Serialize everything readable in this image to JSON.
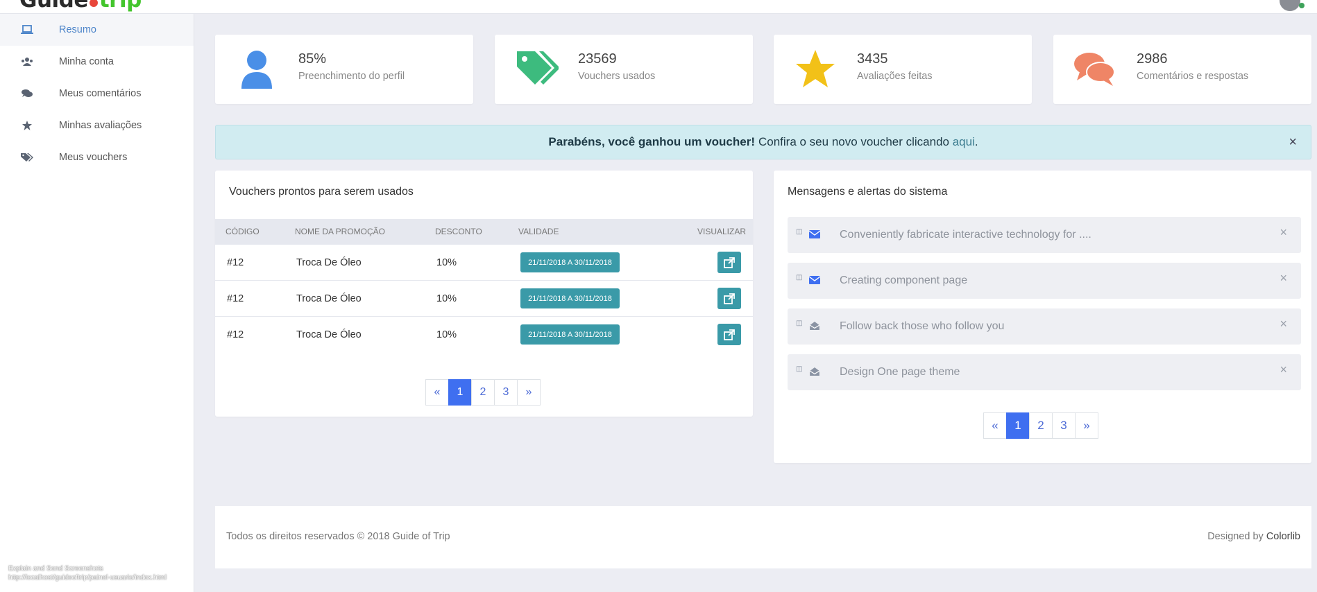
{
  "header": {
    "logo_part1": "Guide",
    "logo_part2": "trip",
    "logo_dot_color": "#e8463a",
    "logo_accent_color": "#43c52d"
  },
  "sidebar": {
    "items": [
      {
        "label": "Resumo",
        "icon": "laptop-icon",
        "active": true
      },
      {
        "label": "Minha conta",
        "icon": "users-icon"
      },
      {
        "label": "Meus comentários",
        "icon": "comments-icon"
      },
      {
        "label": "Minhas avaliações",
        "icon": "star-icon"
      },
      {
        "label": "Meus vouchers",
        "icon": "tags-icon"
      }
    ],
    "active_color": "#4c84c9"
  },
  "stats": [
    {
      "value": "85%",
      "label": "Preenchimento do perfil",
      "icon": "user-icon",
      "color": "#4a8fe7"
    },
    {
      "value": "23569",
      "label": "Vouchers usados",
      "icon": "tags-icon",
      "color": "#3dbb7e"
    },
    {
      "value": "3435",
      "label": "Avaliações feitas",
      "icon": "star-icon",
      "color": "#f2c118"
    },
    {
      "value": "2986",
      "label": "Comentários e respostas",
      "icon": "comments-icon",
      "color": "#ef8566"
    }
  ],
  "alert": {
    "bold": "Parabéns, você ganhou um voucher!",
    "text": "Confira o seu novo voucher clicando",
    "link": "aqui",
    "end": ".",
    "close": "×"
  },
  "vouchers": {
    "title": "Vouchers prontos para serem usados",
    "columns": [
      "CÓDIGO",
      "NOME DA PROMOÇÃO",
      "DESCONTO",
      "VALIDADE",
      "VISUALIZAR"
    ],
    "rows": [
      {
        "code": "#12",
        "name": "Troca De Óleo",
        "discount": "10%",
        "validity": "21/11/2018 A 30/11/2018"
      },
      {
        "code": "#12",
        "name": "Troca De Óleo",
        "discount": "10%",
        "validity": "21/11/2018 A 30/11/2018"
      },
      {
        "code": "#12",
        "name": "Troca De Óleo",
        "discount": "10%",
        "validity": "21/11/2018 A 30/11/2018"
      }
    ],
    "pagination": [
      "«",
      "1",
      "2",
      "3",
      "»"
    ],
    "current_page": "1"
  },
  "messages": {
    "title": "Mensagens e alertas do sistema",
    "items": [
      {
        "text": "Conveniently fabricate interactive technology for ....",
        "icon": "envelope-icon",
        "unread": true
      },
      {
        "text": "Creating component page",
        "icon": "envelope-icon",
        "unread": true
      },
      {
        "text": "Follow back those who follow you",
        "icon": "envelope-open-icon",
        "unread": false
      },
      {
        "text": "Design One page theme",
        "icon": "envelope-open-icon",
        "unread": false
      }
    ],
    "close": "×",
    "pagination": [
      "«",
      "1",
      "2",
      "3",
      "»"
    ],
    "current_page": "1"
  },
  "footer": {
    "copyright": "Todos os direitos reservados © 2018 Guide of Trip",
    "designed_by": "Designed by",
    "designer": "Colorlib"
  },
  "statusbar": {
    "line1": "Explain and Send Screenshots",
    "line2": "http://localhost/guideoftrip/painel-usuario/index.html"
  }
}
